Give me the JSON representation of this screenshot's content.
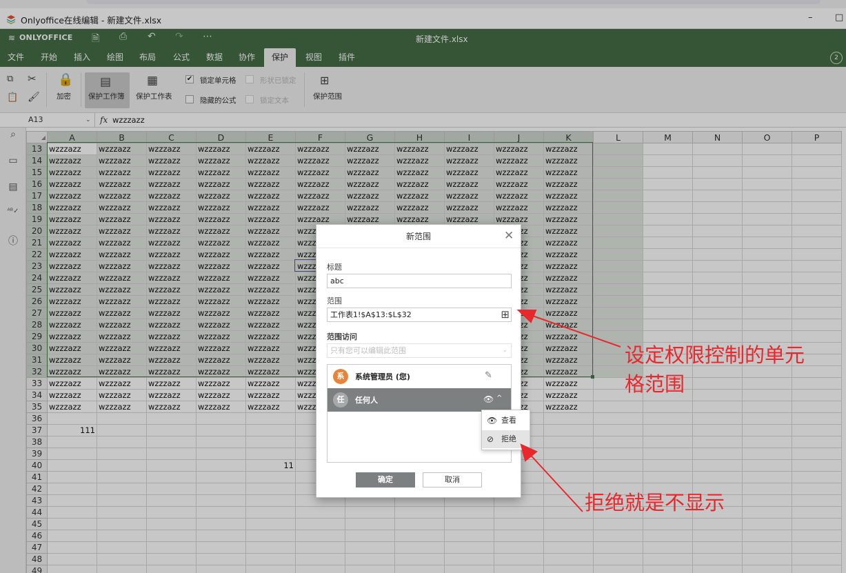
{
  "window": {
    "title": "Onlyoffice在线编辑 - 新建文件.xlsx",
    "min": "–",
    "restore": "□"
  },
  "app": {
    "brand": "ONLYOFFICE",
    "document": "新建文件.xlsx",
    "account_badge": "2"
  },
  "menu": [
    "文件",
    "开始",
    "插入",
    "绘图",
    "布局",
    "公式",
    "数据",
    "协作",
    "保护",
    "视图",
    "插件"
  ],
  "menu_active": "保护",
  "toolbar": {
    "encrypt": "加密",
    "protect_workbook": "保护工作簿",
    "protect_sheet": "保护工作表",
    "lock_cell": "锁定单元格",
    "lock_cell_checked": "✔",
    "shape_locked": "形状已锁定",
    "hide_formula": "隐藏的公式",
    "lock_text": "锁定文本",
    "protect_range": "保护范围"
  },
  "formula_bar": {
    "name_box": "A13",
    "fx": "fx",
    "value": "wzzzazz"
  },
  "sheet": {
    "columns": [
      "A",
      "B",
      "C",
      "D",
      "E",
      "F",
      "G",
      "H",
      "I",
      "J",
      "K",
      "L",
      "M",
      "N",
      "O",
      "P"
    ],
    "rows": [
      13,
      14,
      15,
      16,
      17,
      18,
      19,
      20,
      21,
      22,
      23,
      24,
      25,
      26,
      27,
      28,
      29,
      30,
      31,
      32,
      33,
      34,
      35,
      36,
      37,
      38,
      39,
      40,
      41,
      42,
      43,
      44,
      45,
      46,
      47,
      48,
      49
    ],
    "fill_text": "wzzzazz",
    "a37": "111",
    "e40": "11"
  },
  "dialog": {
    "title": "新范围",
    "title_label": "标题",
    "title_value": "abc",
    "range_label": "范围",
    "range_value": "工作表1!$A$13:$L$32",
    "access_label": "范围访问",
    "access_value": "只有您可以编辑此范围",
    "users": [
      {
        "avatar": "系",
        "name": "系统管理员 (您)",
        "color": "#e8843a"
      },
      {
        "avatar": "任",
        "name": "任何人",
        "color": "#a5a9a9"
      }
    ],
    "ok": "确定",
    "cancel": "取消"
  },
  "access_menu": {
    "view": "查看",
    "deny": "拒绝"
  },
  "annotations": {
    "range_note_line1": "设定权限控制的单元",
    "range_note_line2": "格范围",
    "deny_note": "拒绝就是不显示"
  }
}
